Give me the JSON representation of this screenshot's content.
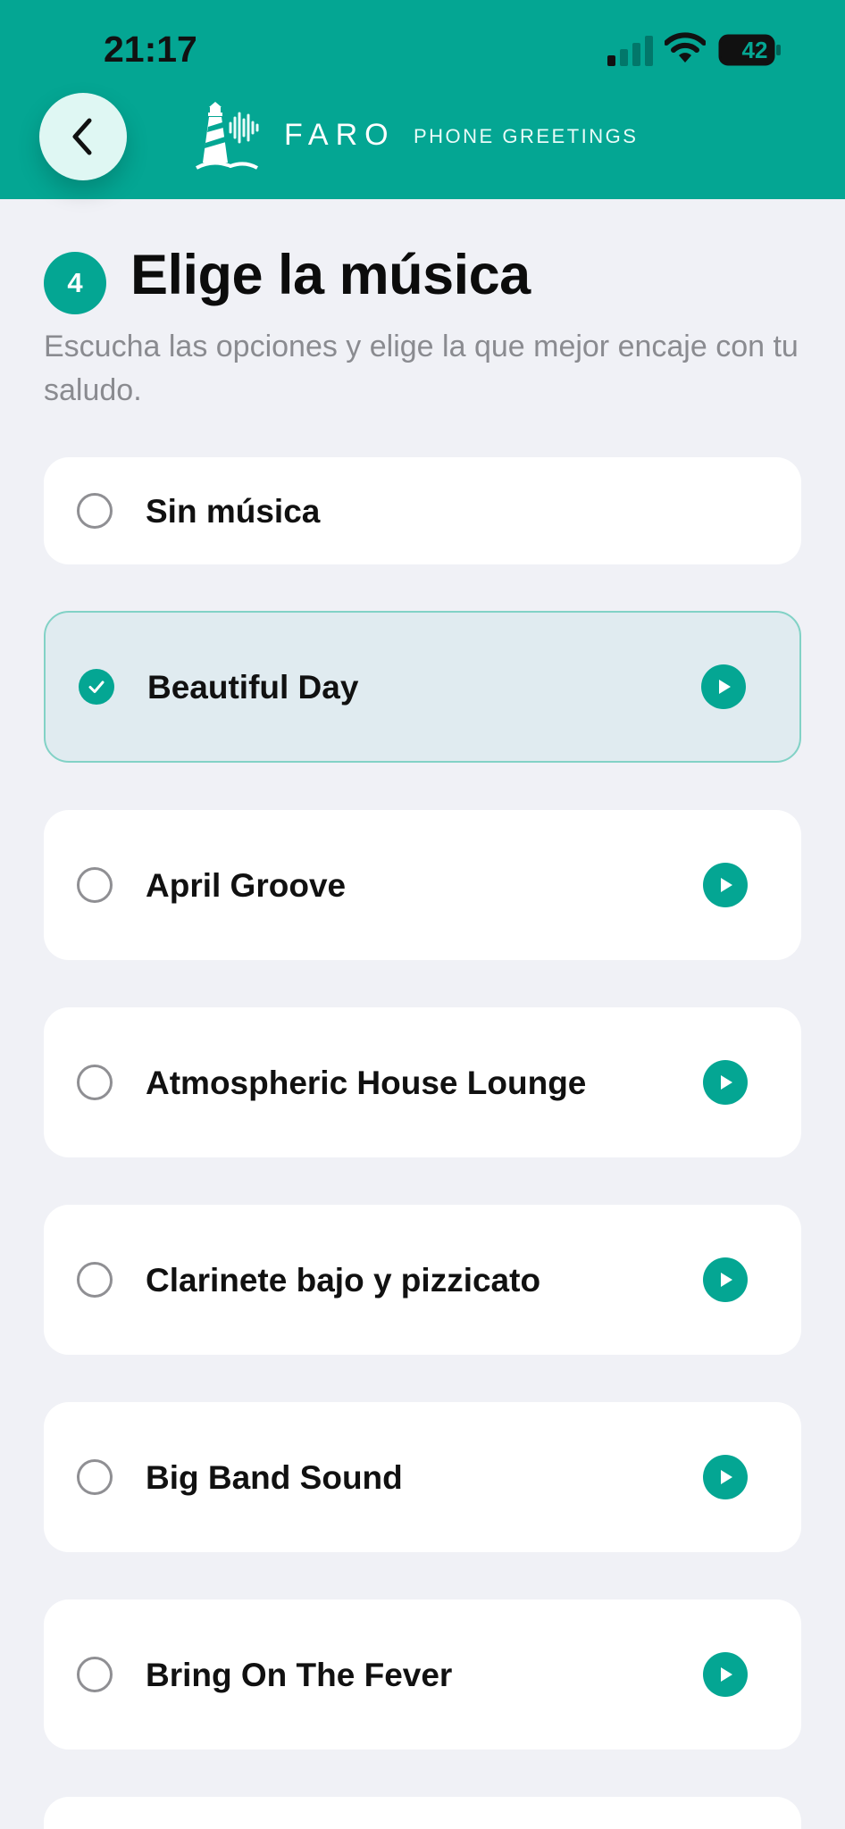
{
  "status_bar": {
    "time": "21:17",
    "battery": "42"
  },
  "brand": {
    "name": "FARO",
    "tagline": "PHONE GREETINGS"
  },
  "step": {
    "number": "4",
    "title": "Elige la música",
    "subtitle": "Escucha las opciones y elige la que mejor encaje con tu saludo."
  },
  "options": [
    {
      "label": "Sin música",
      "selected": false,
      "playable": false
    },
    {
      "label": "Beautiful Day",
      "selected": true,
      "playable": true
    },
    {
      "label": "April Groove",
      "selected": false,
      "playable": true
    },
    {
      "label": "Atmospheric House Lounge",
      "selected": false,
      "playable": true
    },
    {
      "label": "Clarinete bajo y pizzicato",
      "selected": false,
      "playable": true
    },
    {
      "label": "Big Band Sound",
      "selected": false,
      "playable": true
    },
    {
      "label": "Bring On The Fever",
      "selected": false,
      "playable": true
    }
  ],
  "colors": {
    "accent": "#04a693",
    "background": "#f0f1f6",
    "selected_card": "#e0ebf0"
  },
  "icons": {
    "back": "chevron-left-icon",
    "play": "play-icon",
    "check": "check-icon",
    "logo": "lighthouse-icon"
  }
}
